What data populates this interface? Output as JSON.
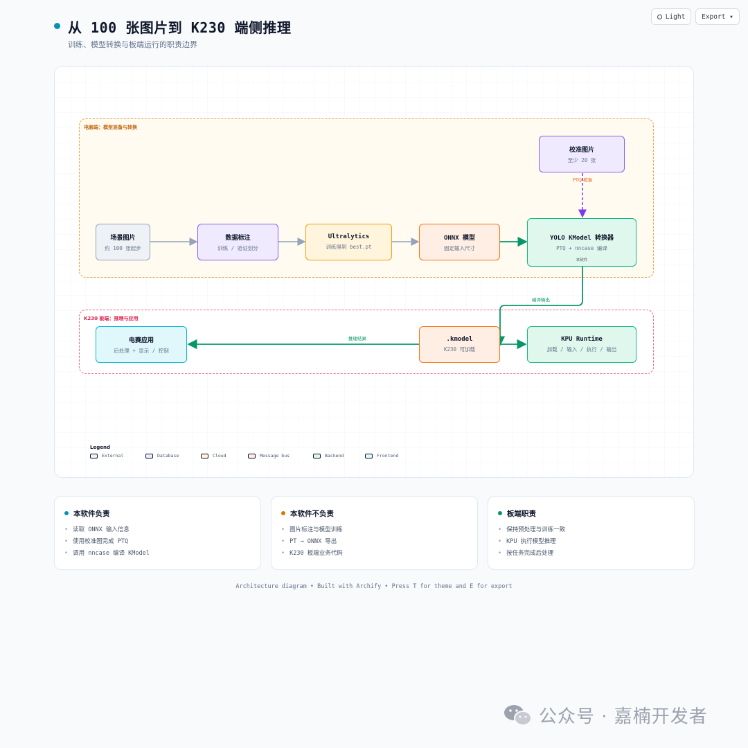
{
  "header": {
    "title": "从 100 张图片到 K230 端侧推理",
    "subtitle": "训练、模型转换与板端运行的职责边界",
    "light_label": "Light",
    "export_label": "Export ▾"
  },
  "diagram": {
    "zones": [
      {
        "id": "pc",
        "label": "电脑端：模型准备与转换"
      },
      {
        "id": "k230",
        "label": "K230 板端：推理与应用"
      }
    ],
    "nodes": {
      "scene": {
        "title": "场景图片",
        "subtitle": "约 100 张起步",
        "type": "external"
      },
      "annotate": {
        "title": "数据标注",
        "subtitle": "训练 / 验证划分",
        "type": "database"
      },
      "ultra": {
        "title": "Ultralytics",
        "subtitle": "训练得到 best.pt",
        "type": "cloud"
      },
      "onnx": {
        "title": "ONNX 模型",
        "subtitle": "固定输入尺寸",
        "type": "message-bus"
      },
      "calib": {
        "title": "校准图片",
        "subtitle": "至少 20 张",
        "type": "database"
      },
      "converter": {
        "title": "YOLO KModel 转换器",
        "subtitle": "PTQ + nncase 编译",
        "extra": "本软件",
        "type": "backend"
      },
      "kmodel": {
        "title": ".kmodel",
        "subtitle": "K230 可加载",
        "type": "message-bus"
      },
      "kpu": {
        "title": "KPU Runtime",
        "subtitle": "加载 / 输入 / 执行 / 输出",
        "type": "backend"
      },
      "app": {
        "title": "电赛应用",
        "subtitle": "后处理 + 显示 / 控制",
        "type": "frontend"
      }
    },
    "edge_labels": {
      "ptq": "PTQ 校准",
      "deploy": "编译输出",
      "result": "推理结果"
    }
  },
  "legend": {
    "title": "Legend",
    "items": [
      {
        "label": "External",
        "type": "external"
      },
      {
        "label": "Database",
        "type": "database"
      },
      {
        "label": "Cloud",
        "type": "cloud"
      },
      {
        "label": "Message bus",
        "type": "message-bus"
      },
      {
        "label": "Backend",
        "type": "backend"
      },
      {
        "label": "Frontend",
        "type": "frontend"
      }
    ]
  },
  "cards": [
    {
      "title": "本软件负责",
      "color": "#0891b2",
      "items": [
        "读取 ONNX 输入信息",
        "使用校准图完成 PTQ",
        "调用 nncase 编译 KModel"
      ]
    },
    {
      "title": "本软件不负责",
      "color": "#d97706",
      "items": [
        "图片标注与模型训练",
        "PT → ONNX 导出",
        "K230 板端业务代码"
      ]
    },
    {
      "title": "板端职责",
      "color": "#059669",
      "items": [
        "保持预处理与训练一致",
        "KPU 执行模型推理",
        "按任务完成后处理"
      ]
    }
  ],
  "footer": "Architecture diagram • Built with Archify • Press T for theme and E for export",
  "watermark": "公众号 · 嘉楠开发者"
}
